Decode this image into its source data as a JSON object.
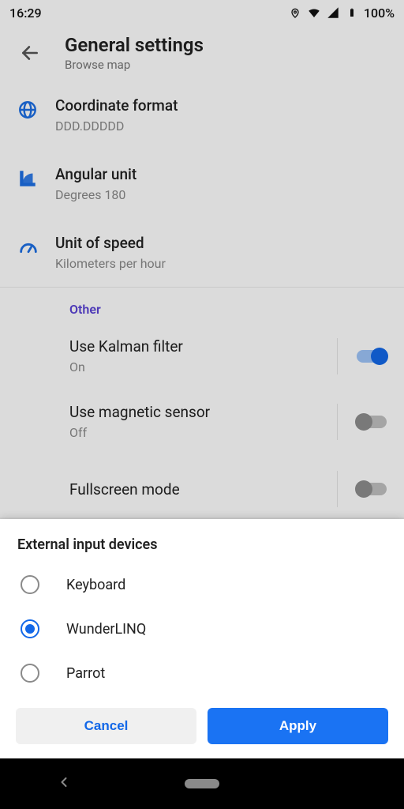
{
  "status": {
    "time": "16:29",
    "battery": "100%"
  },
  "appbar": {
    "title": "General settings",
    "subtitle": "Browse map"
  },
  "rows": {
    "coord": {
      "title": "Coordinate format",
      "value": "DDD.DDDDD"
    },
    "angular": {
      "title": "Angular unit",
      "value": "Degrees 180"
    },
    "speed": {
      "title": "Unit of speed",
      "value": "Kilometers per hour"
    }
  },
  "section_other": "Other",
  "toggles": {
    "kalman": {
      "title": "Use Kalman filter",
      "value": "On"
    },
    "magnetic": {
      "title": "Use magnetic sensor",
      "value": "Off"
    },
    "fullscreen": {
      "title": "Fullscreen mode"
    }
  },
  "sheet": {
    "title": "External input devices",
    "options": {
      "opt0": "Keyboard",
      "opt1": "WunderLINQ",
      "opt2": "Parrot"
    },
    "selected": "opt1",
    "cancel": "Cancel",
    "apply": "Apply"
  }
}
